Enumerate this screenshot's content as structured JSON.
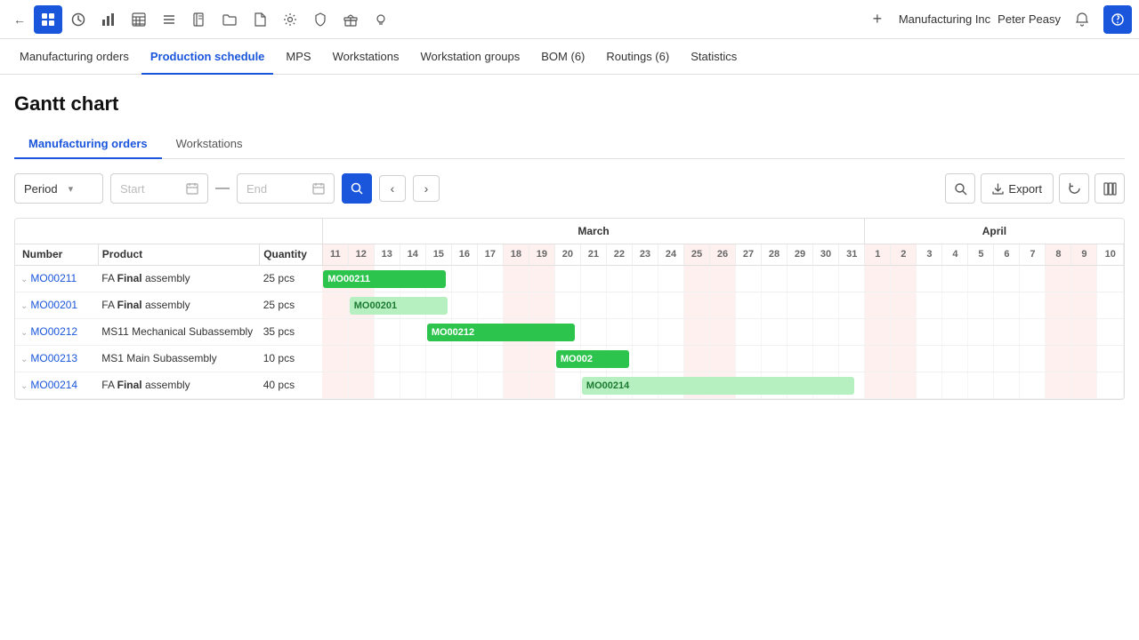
{
  "topbar": {
    "icons": [
      {
        "name": "back-icon",
        "symbol": "←",
        "active": false
      },
      {
        "name": "app-icon-blue",
        "symbol": "◼",
        "active": true,
        "blue": true
      },
      {
        "name": "clock-icon",
        "symbol": "◔",
        "active": false
      },
      {
        "name": "chart-icon",
        "symbol": "📊",
        "active": false
      },
      {
        "name": "calendar-icon",
        "symbol": "⊞",
        "active": false
      },
      {
        "name": "list-icon",
        "symbol": "☰",
        "active": false
      },
      {
        "name": "book-icon",
        "symbol": "📖",
        "active": false
      },
      {
        "name": "folder-icon",
        "symbol": "🗂",
        "active": false
      },
      {
        "name": "file-icon",
        "symbol": "📁",
        "active": false
      },
      {
        "name": "gear-icon",
        "symbol": "⚙",
        "active": false
      },
      {
        "name": "shield-icon",
        "symbol": "🛡",
        "active": false
      },
      {
        "name": "gift-icon",
        "symbol": "🎁",
        "active": false
      },
      {
        "name": "bulb-icon",
        "symbol": "💡",
        "active": false
      }
    ],
    "plus_label": "+",
    "company": "Manufacturing Inc",
    "user": "Peter Peasy"
  },
  "navbar": {
    "items": [
      {
        "label": "Manufacturing orders",
        "active": false
      },
      {
        "label": "Production schedule",
        "active": true
      },
      {
        "label": "MPS",
        "active": false
      },
      {
        "label": "Workstations",
        "active": false
      },
      {
        "label": "Workstation groups",
        "active": false
      },
      {
        "label": "BOM (6)",
        "active": false
      },
      {
        "label": "Routings (6)",
        "active": false
      },
      {
        "label": "Statistics",
        "active": false
      }
    ]
  },
  "page": {
    "title": "Gantt chart",
    "subtabs": [
      {
        "label": "Manufacturing orders",
        "active": true
      },
      {
        "label": "Workstations",
        "active": false
      }
    ]
  },
  "filterbar": {
    "period_label": "Period",
    "period_arrow": "▾",
    "start_placeholder": "Start",
    "end_placeholder": "End",
    "export_label": "Export"
  },
  "gantt": {
    "columns": {
      "number": "Number",
      "product": "Product",
      "quantity": "Quantity"
    },
    "march_days": [
      11,
      12,
      13,
      14,
      15,
      16,
      17,
      18,
      19,
      20,
      21,
      22,
      23,
      24,
      25,
      26,
      27,
      28,
      29,
      30,
      31
    ],
    "april_days": [
      1,
      2,
      3,
      4,
      5,
      6,
      7,
      8,
      9,
      10
    ],
    "weekends_march": [
      11,
      12,
      18,
      19,
      25,
      26
    ],
    "weekends_april": [
      1,
      2,
      8,
      9
    ],
    "rows": [
      {
        "id": "MO00211",
        "product": "FA Final assembly",
        "quantity": "25 pcs",
        "bar_label": "MO00211",
        "bar_start_day": 11,
        "bar_end_day": 15,
        "bar_type": "green",
        "month": "march"
      },
      {
        "id": "MO00201",
        "product": "FA Final assembly",
        "quantity": "25 pcs",
        "bar_label": "MO00201",
        "bar_start_day": 12,
        "bar_end_day": 15,
        "bar_type": "green-light",
        "month": "march"
      },
      {
        "id": "MO00212",
        "product": "MS11 Mechanical Subassembly",
        "quantity": "35 pcs",
        "bar_label": "MO00212",
        "bar_start_day": 15,
        "bar_end_day": 20,
        "bar_type": "green",
        "month": "march"
      },
      {
        "id": "MO00213",
        "product": "MS1 Main Subassembly",
        "quantity": "10 pcs",
        "bar_label": "MO002",
        "bar_start_day": 20,
        "bar_end_day": 22,
        "bar_type": "green",
        "month": "march"
      },
      {
        "id": "MO00214",
        "product": "FA Final assembly",
        "quantity": "40 pcs",
        "bar_label": "MO00214",
        "bar_start_day": 21,
        "bar_end_day": 31,
        "bar_type": "green-light",
        "month": "march"
      }
    ]
  }
}
